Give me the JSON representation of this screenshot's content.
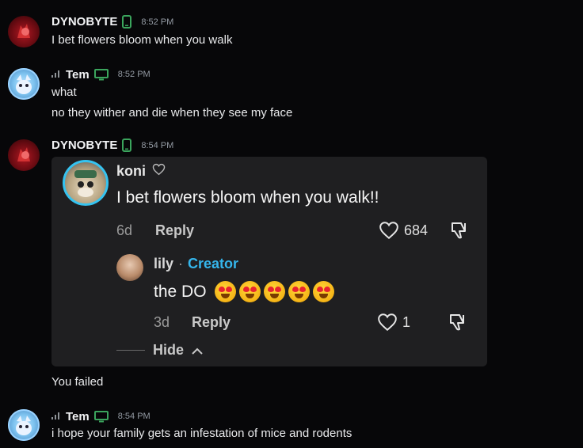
{
  "colors": {
    "background": "#070709",
    "username": "#f2f3f5",
    "timestamp": "#949ba4",
    "text": "#e9eaec",
    "mobile_icon": "#3ba55d",
    "desktop_icon": "#3ba55d",
    "embed_bg": "#1f1f21",
    "creator": "#35b6ec",
    "avatar_ring": "#35c3f0"
  },
  "messages": [
    {
      "user": "DYNOBYTE",
      "device": "mobile-icon",
      "time": "8:52 PM",
      "lines": [
        "I bet flowers bloom when you walk"
      ]
    },
    {
      "user": "Tem",
      "device": "desktop-icon",
      "time": "8:52 PM",
      "lines": [
        "what",
        "no they wither and die when they see my face"
      ]
    },
    {
      "user": "DYNOBYTE",
      "device": "mobile-icon",
      "time": "8:54 PM",
      "lines": [
        "You failed"
      ]
    },
    {
      "user": "Tem",
      "device": "desktop-icon",
      "time": "8:54 PM",
      "lines": [
        "i hope your family gets an infestation of mice and rodents"
      ]
    }
  ],
  "embed": {
    "top_comment": {
      "author": "koni",
      "text": "I bet flowers bloom when you walk!!",
      "age": "6d",
      "reply_label": "Reply",
      "likes": "684"
    },
    "reply_comment": {
      "author": "lily",
      "separator": "·",
      "badge": "Creator",
      "text": "the DO",
      "emoji": [
        "heart-eyes-emoji",
        "heart-eyes-emoji",
        "heart-eyes-emoji",
        "heart-eyes-emoji",
        "heart-eyes-emoji"
      ],
      "age": "3d",
      "reply_label": "Reply",
      "likes": "1"
    },
    "hide_label": "Hide"
  }
}
